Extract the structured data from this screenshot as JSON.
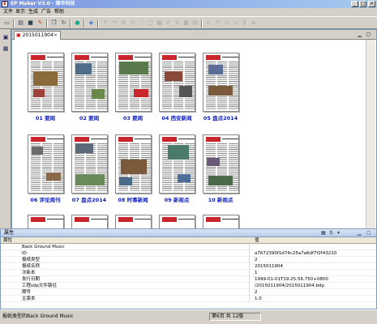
{
  "window": {
    "title": "EP Maker V3.0 - 锦华科技",
    "min": "_",
    "max": "□",
    "close": "×"
  },
  "menu": [
    "文件",
    "显示",
    "生成",
    "广告",
    "帮助"
  ],
  "editor_tab": {
    "label": "2015011904",
    "close": "×"
  },
  "pages": [
    {
      "label": "01  要闻"
    },
    {
      "label": "02  要闻"
    },
    {
      "label": "03  要闻"
    },
    {
      "label": "04  西安新闻"
    },
    {
      "label": "05  盘点2014"
    },
    {
      "label": "06  评论周刊"
    },
    {
      "label": "07  盘点2014"
    },
    {
      "label": "08  时事新闻"
    },
    {
      "label": "09  新视点"
    },
    {
      "label": "10  新视点"
    }
  ],
  "properties": {
    "title": "属性",
    "col_key": "属性",
    "col_value": "值",
    "rows": [
      {
        "k": "Back Ground Music",
        "v": ""
      },
      {
        "k": "ID",
        "v": "a7672390f1d74c25a7a6df7f2f43210"
      },
      {
        "k": "报纸类型",
        "v": "2"
      },
      {
        "k": "报纸名称",
        "v": "2015011904"
      },
      {
        "k": "次新本",
        "v": "1"
      },
      {
        "k": "发行日期",
        "v": "1999-01-01T19:25:56.750+0800"
      },
      {
        "k": "工程sdp文件路径",
        "v": "/2015011904/2015011904.bdp"
      },
      {
        "k": "期号",
        "v": "2"
      },
      {
        "k": "主版本",
        "v": "1.0"
      }
    ]
  },
  "status": {
    "text": "报纸类型的Back Ground Music",
    "page": "第6页 共 12版"
  },
  "colors": {
    "accent": "#1020c0",
    "masthead": "#c8262b"
  }
}
